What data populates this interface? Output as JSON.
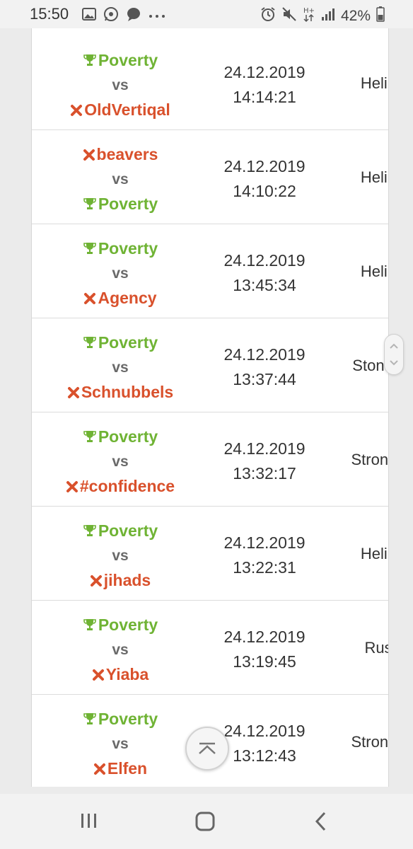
{
  "status_bar": {
    "time": "15:50",
    "battery_percent": "42%",
    "left_icons": [
      "image-icon",
      "whatsapp-icon",
      "chat-bubble-icon",
      "more-dots-icon"
    ],
    "right_icons": [
      "alarm-icon",
      "mute-icon",
      "data-transfer-icon",
      "signal-icon",
      "battery-icon"
    ]
  },
  "colors": {
    "winner": "#6fb334",
    "loser": "#d9512c"
  },
  "vs_label": "vs",
  "matches": [
    {
      "winner": "Poverty",
      "loser": "OldVertiqal",
      "winner_first": true,
      "date": "24.12.2019",
      "time": "14:14:21",
      "map": "Helip"
    },
    {
      "winner": "Poverty",
      "loser": "beavers",
      "winner_first": false,
      "date": "24.12.2019",
      "time": "14:10:22",
      "map": "Helip"
    },
    {
      "winner": "Poverty",
      "loser": "Agency",
      "winner_first": true,
      "date": "24.12.2019",
      "time": "13:45:34",
      "map": "Helip"
    },
    {
      "winner": "Poverty",
      "loser": "Schnubbels",
      "winner_first": true,
      "date": "24.12.2019",
      "time": "13:37:44",
      "map": "Stoneis"
    },
    {
      "winner": "Poverty",
      "loser": "#confidence",
      "winner_first": true,
      "date": "24.12.2019",
      "time": "13:32:17",
      "map": "Strongh"
    },
    {
      "winner": "Poverty",
      "loser": "jihads",
      "winner_first": true,
      "date": "24.12.2019",
      "time": "13:22:31",
      "map": "Helip"
    },
    {
      "winner": "Poverty",
      "loser": "Yiaba",
      "winner_first": true,
      "date": "24.12.2019",
      "time": "13:19:45",
      "map": "Rus"
    },
    {
      "winner": "Poverty",
      "loser": "Elfen",
      "winner_first": true,
      "date": "24.12.2019",
      "time": "13:12:43",
      "map": "Strongh"
    }
  ],
  "nav": {
    "recent": "recent-apps-icon",
    "home": "home-icon",
    "back": "back-icon"
  }
}
